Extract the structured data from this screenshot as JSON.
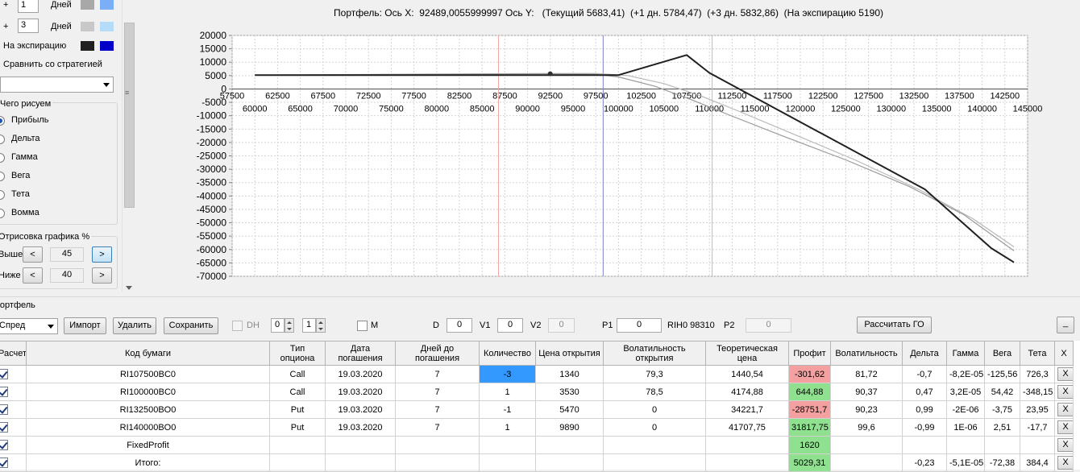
{
  "left_panel": {
    "spin1": {
      "prefix": "+",
      "value": "1",
      "label": "Дней"
    },
    "spin2": {
      "prefix": "+",
      "value": "3",
      "label": "Дней"
    },
    "expiry_label": "На экспирацию",
    "colors": {
      "row1_a": "#a8a8a8",
      "row1_b": "#7aaef5",
      "row2_a": "#c8c8c8",
      "row2_b": "#b4dcf8",
      "expiry_a": "#202020",
      "expiry_b": "#0000c8"
    },
    "compare_label": "Сравнить со стратегией",
    "compare_value": "",
    "draw_group_title": "Чего рисуем",
    "radios": [
      "Прибыль",
      "Дельта",
      "Гамма",
      "Вега",
      "Тета",
      "Вомма"
    ],
    "selected_radio": "Прибыль",
    "draw_pct_title": "Отрисовка графика %",
    "above": {
      "label": "Выше",
      "value": "45"
    },
    "below": {
      "label": "Ниже",
      "value": "40"
    },
    "prev": "<",
    "next": ">"
  },
  "chart": {
    "title": "Портфель: Ось X:  92489,0055999997 Ось Y:   (Текущий 5683,41)  (+1 дн. 5784,47)  (+3 дн. 5832,86)  (На экспирацию 5190)"
  },
  "chart_data": {
    "type": "line",
    "xlim": [
      57500,
      145000
    ],
    "ylim": [
      -70000,
      20000
    ],
    "x_ticks_top": [
      57500,
      62500,
      67500,
      72500,
      77500,
      82500,
      87500,
      92500,
      97500,
      102500,
      107500,
      112500,
      117500,
      122500,
      127500,
      132500,
      137500,
      142500
    ],
    "x_ticks_bottom": [
      60000,
      65000,
      70000,
      75000,
      80000,
      85000,
      90000,
      95000,
      100000,
      105000,
      110000,
      115000,
      120000,
      125000,
      130000,
      135000,
      140000,
      145000
    ],
    "y_ticks": [
      20000,
      15000,
      10000,
      5000,
      0,
      -5000,
      -10000,
      -15000,
      -20000,
      -25000,
      -30000,
      -35000,
      -40000,
      -45000,
      -50000,
      -55000,
      -60000,
      -65000,
      -70000
    ],
    "vlines": [
      {
        "x": 86800,
        "color": "#f0a8a8"
      },
      {
        "x": 98310,
        "color": "#8080c8"
      },
      {
        "x": 110300,
        "color": "#f0a8a8"
      }
    ],
    "marker": {
      "x": 92489,
      "y": 5683
    },
    "series": [
      {
        "color": "#202020",
        "width": 2,
        "points": [
          [
            60000,
            5190
          ],
          [
            100000,
            5190
          ],
          [
            107500,
            12700
          ],
          [
            110000,
            6000
          ],
          [
            133700,
            -37500
          ],
          [
            141000,
            -59500
          ],
          [
            143500,
            -64800
          ]
        ]
      },
      {
        "color": "#9a9a9a",
        "width": 1.2,
        "points": [
          [
            60000,
            5190
          ],
          [
            92489,
            5683
          ],
          [
            97500,
            5500
          ],
          [
            100000,
            4500
          ],
          [
            104000,
            1000
          ],
          [
            108000,
            -4000
          ],
          [
            112000,
            -9500
          ],
          [
            118000,
            -17500
          ],
          [
            125000,
            -26500
          ],
          [
            132000,
            -36500
          ],
          [
            138000,
            -47000
          ],
          [
            143500,
            -60500
          ]
        ]
      },
      {
        "color": "#b8b8b8",
        "width": 1.2,
        "points": [
          [
            60000,
            5190
          ],
          [
            92489,
            5784
          ],
          [
            97500,
            5800
          ],
          [
            101000,
            5000
          ],
          [
            105000,
            2000
          ],
          [
            109000,
            -2500
          ],
          [
            113000,
            -8000
          ],
          [
            119000,
            -16500
          ],
          [
            126000,
            -26500
          ],
          [
            133000,
            -37500
          ],
          [
            139000,
            -48500
          ],
          [
            143500,
            -59000
          ]
        ]
      }
    ]
  },
  "portfolio": {
    "label": "Портфель",
    "strategy": "Спред",
    "import": "Импорт",
    "delete": "Удалить",
    "save": "Сохранить",
    "dh": "DH",
    "spin_a": "0",
    "spin_b": "1",
    "m": "M",
    "d_label": "D",
    "d_value": "0",
    "v1_label": "V1",
    "v1_value": "0",
    "v2_label": "V2",
    "v2_value": "0",
    "p1_label": "P1",
    "p1_value": "0",
    "ticker": "RIH0 98310",
    "p2_label": "P2",
    "p2_value": "0",
    "calc_go": "Рассчитать ГО",
    "minimize": "_"
  },
  "table": {
    "columns": [
      "Расчет",
      "Код бумаги",
      "Тип опциона",
      "Дата погашения",
      "Дней до погашения",
      "Количество",
      "Цена открытия",
      "Волатильность открытия",
      "Теоретическая цена",
      "Профит",
      "Волатильность",
      "Дельта",
      "Гамма",
      "Вега",
      "Тета",
      "X"
    ],
    "rows": [
      {
        "code": "RI107500BC0",
        "type": "Call",
        "date": "19.03.2020",
        "days": "7",
        "qty": "-3",
        "open": "1340",
        "vol_open": "79,3",
        "theor": "1440,54",
        "profit": "-301,62",
        "vol": "81,72",
        "delta": "-0,7",
        "gamma": "-8,2E-05",
        "vega": "-125,56",
        "theta": "726,3",
        "x": "X"
      },
      {
        "code": "RI100000BC0",
        "type": "Call",
        "date": "19.03.2020",
        "days": "7",
        "qty": "1",
        "open": "3530",
        "vol_open": "78,5",
        "theor": "4174,88",
        "profit": "644,88",
        "vol": "90,37",
        "delta": "0,47",
        "gamma": "3,2E-05",
        "vega": "54,42",
        "theta": "-348,15",
        "x": "X"
      },
      {
        "code": "RI132500BO0",
        "type": "Put",
        "date": "19.03.2020",
        "days": "7",
        "qty": "-1",
        "open": "5470",
        "vol_open": "0",
        "theor": "34221,7",
        "profit": "-28751,7",
        "vol": "90,23",
        "delta": "0,99",
        "gamma": "-2E-06",
        "vega": "-3,75",
        "theta": "23,95",
        "x": "X"
      },
      {
        "code": "RI140000BO0",
        "type": "Put",
        "date": "19.03.2020",
        "days": "7",
        "qty": "1",
        "open": "9890",
        "vol_open": "0",
        "theor": "41707,75",
        "profit": "31817,75",
        "vol": "99,6",
        "delta": "-0,99",
        "gamma": "1E-06",
        "vega": "2,51",
        "theta": "-17,7",
        "x": "X"
      },
      {
        "code": "FixedProfit",
        "type": "",
        "date": "",
        "days": "",
        "qty": "",
        "open": "",
        "vol_open": "",
        "theor": "",
        "profit": "1620",
        "vol": "",
        "delta": "",
        "gamma": "",
        "vega": "",
        "theta": "",
        "x": "X"
      },
      {
        "code": "Итого:",
        "type": "",
        "date": "",
        "days": "",
        "qty": "",
        "open": "",
        "vol_open": "",
        "theor": "",
        "profit": "5029,31",
        "vol": "",
        "delta": "-0,23",
        "gamma": "-5,1E-05",
        "vega": "-72,38",
        "theta": "384,4",
        "x": "X"
      }
    ]
  }
}
